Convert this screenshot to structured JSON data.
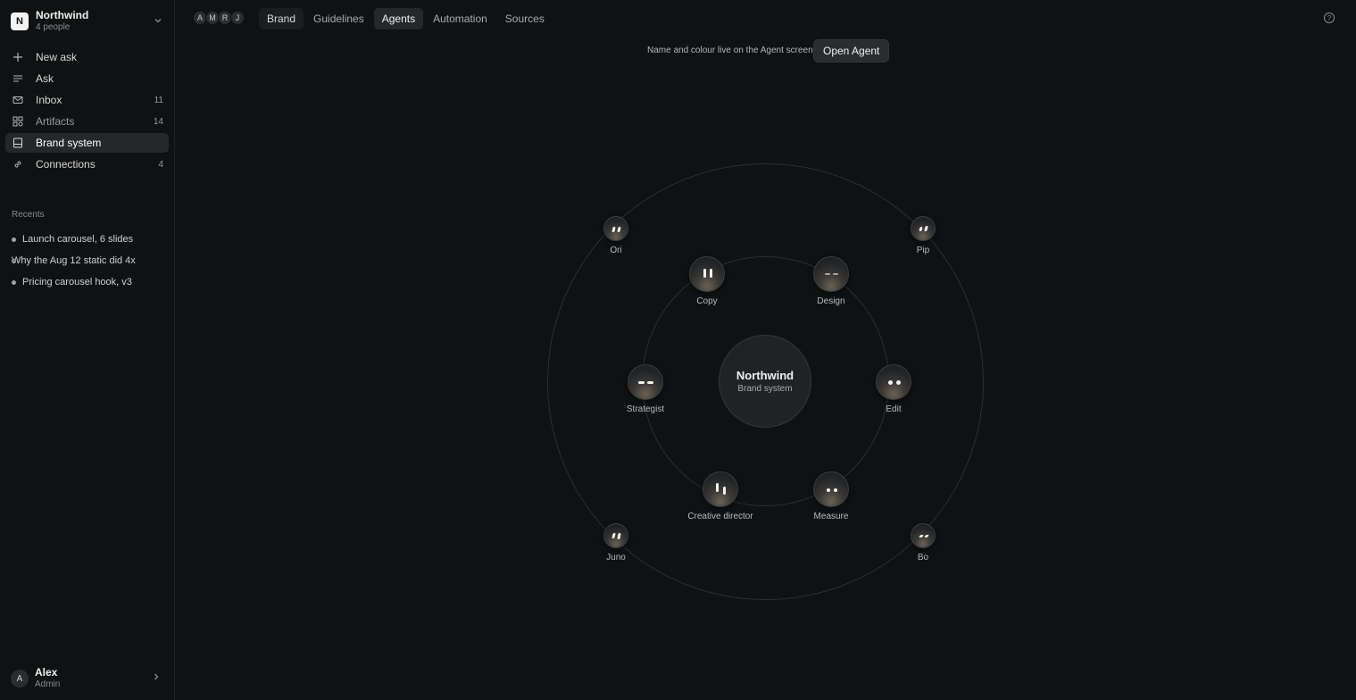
{
  "workspace": {
    "initial": "N",
    "name": "Northwind",
    "subtitle": "4 people"
  },
  "nav": [
    {
      "label": "New ask",
      "icon": "plus-icon",
      "count": ""
    },
    {
      "label": "Ask",
      "icon": "lines-icon",
      "count": ""
    },
    {
      "label": "Inbox",
      "icon": "mail-icon",
      "count": "11"
    },
    {
      "label": "Artifacts",
      "icon": "grid-icon",
      "count": "14"
    },
    {
      "label": "Brand system",
      "icon": "book-icon",
      "count": ""
    },
    {
      "label": "Connections",
      "icon": "link-icon",
      "count": "4"
    }
  ],
  "recents": {
    "title": "Recents",
    "items": [
      {
        "label": "Launch carousel, 6 slides"
      },
      {
        "label": "Why the Aug 12 static did 4x"
      },
      {
        "label": "Pricing carousel hook, v3"
      }
    ]
  },
  "user": {
    "initial": "A",
    "name": "Alex",
    "role": "Admin"
  },
  "members": [
    "A",
    "M",
    "R",
    "J"
  ],
  "tabs": [
    {
      "label": "Brand"
    },
    {
      "label": "Guidelines"
    },
    {
      "label": "Agents"
    },
    {
      "label": "Automation"
    },
    {
      "label": "Sources"
    }
  ],
  "active_tab": "Agents",
  "notice": {
    "text": "Name and colour live on the Agent screen",
    "button": "Open Agent"
  },
  "center": {
    "title": "Northwind",
    "subtitle": "Brand system"
  },
  "agents": {
    "ori": "Ori",
    "pip": "Pip",
    "copy": "Copy",
    "design": "Design",
    "strategist": "Strategist",
    "edit": "Edit",
    "creative_director": "Creative director",
    "measure": "Measure",
    "juno": "Juno",
    "bo": "Bo"
  },
  "colors": {
    "background": "#0f1112",
    "accent": "#f4f1ea",
    "active_bg": "#25282a"
  }
}
